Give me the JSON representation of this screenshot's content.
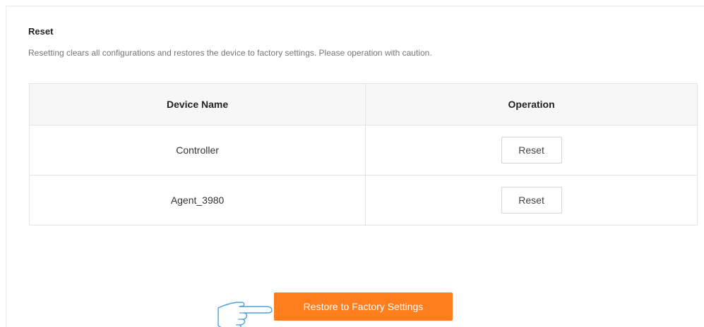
{
  "reset_section": {
    "title": "Reset",
    "description": "Resetting clears all configurations and restores the device to factory settings. Please operation with caution."
  },
  "table": {
    "columns": [
      "Device Name",
      "Operation"
    ],
    "rows": [
      {
        "device_name": "Controller",
        "operation_label": "Reset"
      },
      {
        "device_name": "Agent_3980",
        "operation_label": "Reset"
      }
    ]
  },
  "restore_button": {
    "label": "Restore to Factory Settings"
  },
  "colors": {
    "accent": "#ff7d1d"
  },
  "icons": {
    "pointer": "pointing-hand-icon"
  }
}
